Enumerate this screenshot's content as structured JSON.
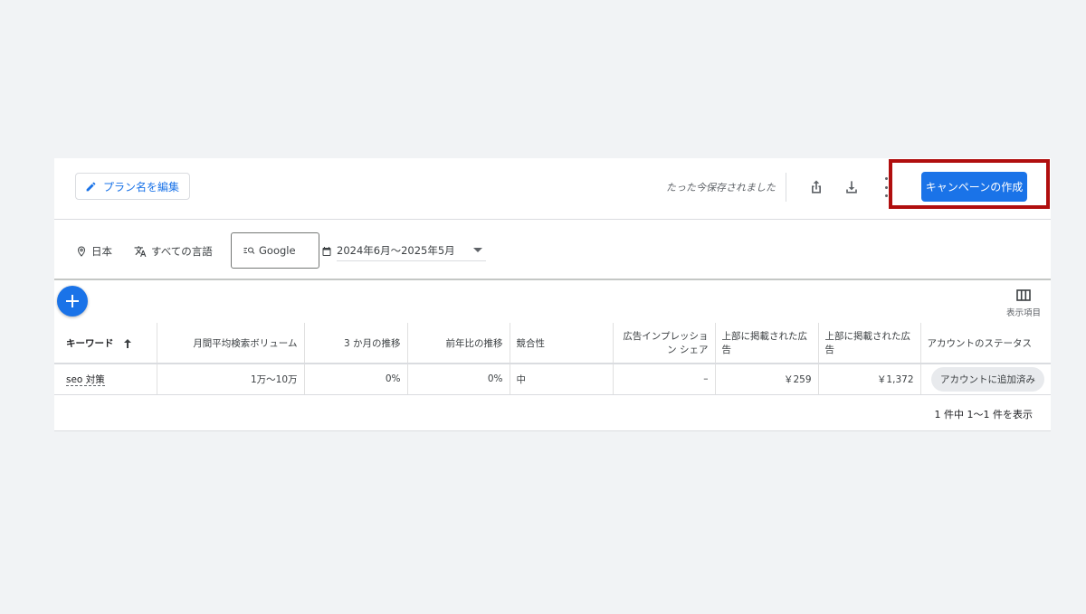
{
  "toolbar": {
    "rename_label": "プラン名を編集",
    "saved_status": "たった今保存されました",
    "create_campaign_label": "キャンペーンの作成",
    "icons": [
      "pencil-icon",
      "share-icon",
      "download-icon",
      "more-vert-icon"
    ],
    "accent_color": "#1a73e8",
    "highlight_color": "#b00e0e"
  },
  "filters": {
    "location": "日本",
    "language": "すべての言語",
    "network": "Google",
    "date_range": "2024年6月〜2025年5月"
  },
  "columns_button_label": "表示項目",
  "table": {
    "headers": {
      "keyword": "キーワード",
      "avg_monthly": "月間平均検索ボリューム",
      "three_month": "3 か月の推移",
      "yoy": "前年比の推移",
      "competition": "競合性",
      "impression_share": "広告インプレッション シェア",
      "top_bid_low": "上部に掲載された広告",
      "top_bid_high": "上部に掲載された広告",
      "account_status": "アカウントのステータス"
    },
    "rows": [
      {
        "keyword": "seo 対策",
        "avg_monthly": "1万～10万",
        "three_month": "0%",
        "yoy": "0%",
        "competition": "中",
        "impression_share": "–",
        "top_bid_low": "￥259",
        "top_bid_high": "￥1,372",
        "account_status": "アカウントに追加済み"
      }
    ]
  },
  "footer": {
    "count_text": "1 件中 1〜1 件を表示"
  }
}
